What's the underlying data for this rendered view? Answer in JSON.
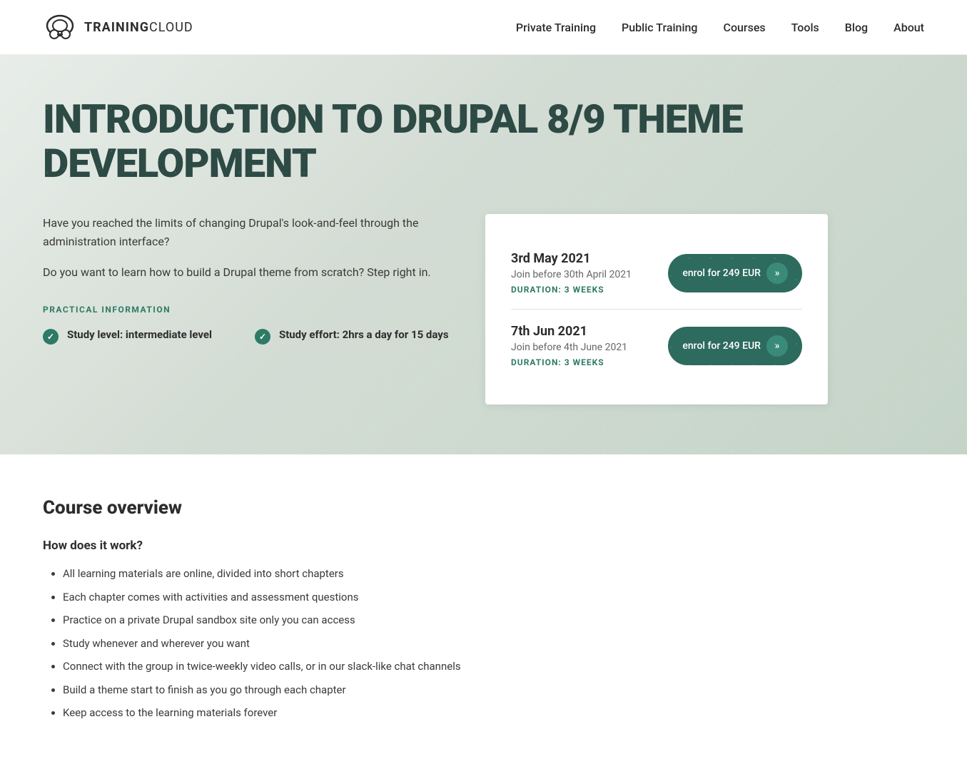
{
  "header": {
    "logo_text_bold": "TRAINING",
    "logo_text_light": "CLOUD",
    "nav": [
      {
        "label": "Private Training",
        "id": "private-training"
      },
      {
        "label": "Public Training",
        "id": "public-training"
      },
      {
        "label": "Courses",
        "id": "courses"
      },
      {
        "label": "Tools",
        "id": "tools"
      },
      {
        "label": "Blog",
        "id": "blog"
      },
      {
        "label": "About",
        "id": "about"
      }
    ]
  },
  "hero": {
    "title": "INTRODUCTION TO DRUPAL 8/9 THEME DEVELOPMENT",
    "intro_p1": "Have you reached the limits of changing Drupal's look-and-feel through the administration interface?",
    "intro_p2": "Do you want to learn how to build a Drupal theme from scratch? Step right in.",
    "practical_label": "PRACTICAL INFORMATION",
    "check_items": [
      {
        "label": "Study level: intermediate level"
      },
      {
        "label": "Study effort: 2hrs a day for 15 days"
      }
    ],
    "sessions": [
      {
        "date": "3rd May 2021",
        "join_before": "Join before 30th April 2021",
        "duration": "DURATION: 3 WEEKS",
        "enrol_label": "enrol for 249 EUR"
      },
      {
        "date": "7th Jun 2021",
        "join_before": "Join before 4th June 2021",
        "duration": "DURATION: 3 WEEKS",
        "enrol_label": "enrol for 249 EUR"
      }
    ]
  },
  "main": {
    "course_overview_title": "Course overview",
    "how_it_works_title": "How does it work?",
    "how_it_works_items": [
      "All learning materials are online, divided into short chapters",
      "Each chapter comes with activities and assessment questions",
      "Practice on a private Drupal sandbox site only you can access",
      "Study whenever and wherever you want",
      "Connect with the group in twice-weekly video calls, or in our slack-like chat channels",
      "Build a theme start to finish as you go through each chapter",
      "Keep access to the learning materials forever"
    ]
  },
  "colors": {
    "accent": "#2d7a65",
    "accent_dark": "#2d6b5e",
    "hero_title": "#2d4a45",
    "text": "#2d2d2d",
    "text_muted": "#666666"
  }
}
